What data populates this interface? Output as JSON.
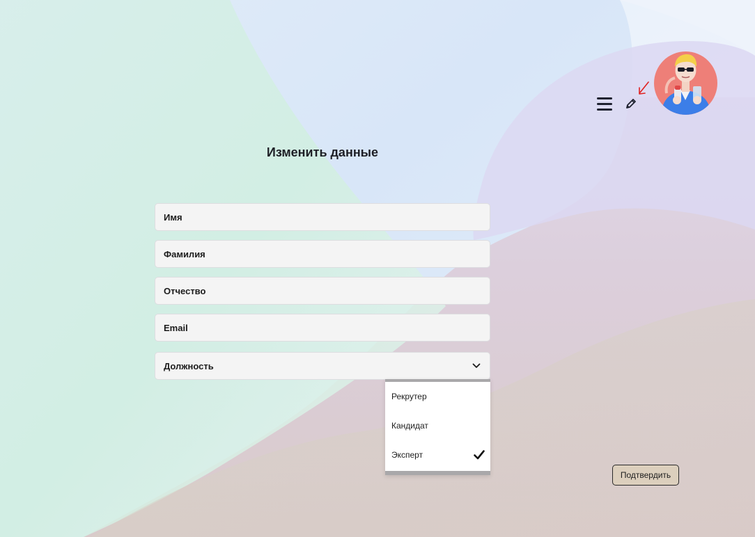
{
  "header": {
    "menu_icon": "hamburger-menu-icon",
    "edit_icon": "pencil-icon",
    "annotation_icon": "red-arrow-icon",
    "avatar_alt": "user-avatar-3d-character"
  },
  "form": {
    "title": "Изменить данные",
    "fields": {
      "first_name": {
        "placeholder": "Имя",
        "value": ""
      },
      "last_name": {
        "placeholder": "Фамилия",
        "value": ""
      },
      "middle_name": {
        "placeholder": "Отчество",
        "value": ""
      },
      "email": {
        "placeholder": "Email",
        "value": ""
      }
    },
    "position": {
      "label": "Должность",
      "chevron_icon": "chevron-down-icon",
      "expanded": true,
      "options": [
        {
          "label": "Рекрутер",
          "selected": false
        },
        {
          "label": "Кандидат",
          "selected": false
        },
        {
          "label": "Эксперт",
          "selected": true
        }
      ]
    },
    "submit_label": "Подтвердить"
  },
  "colors": {
    "field_background": "#f4f4f4",
    "button_background": "#dccfbd",
    "arrow_annotation": "#e02020",
    "avatar_background": "#ee7f78"
  }
}
